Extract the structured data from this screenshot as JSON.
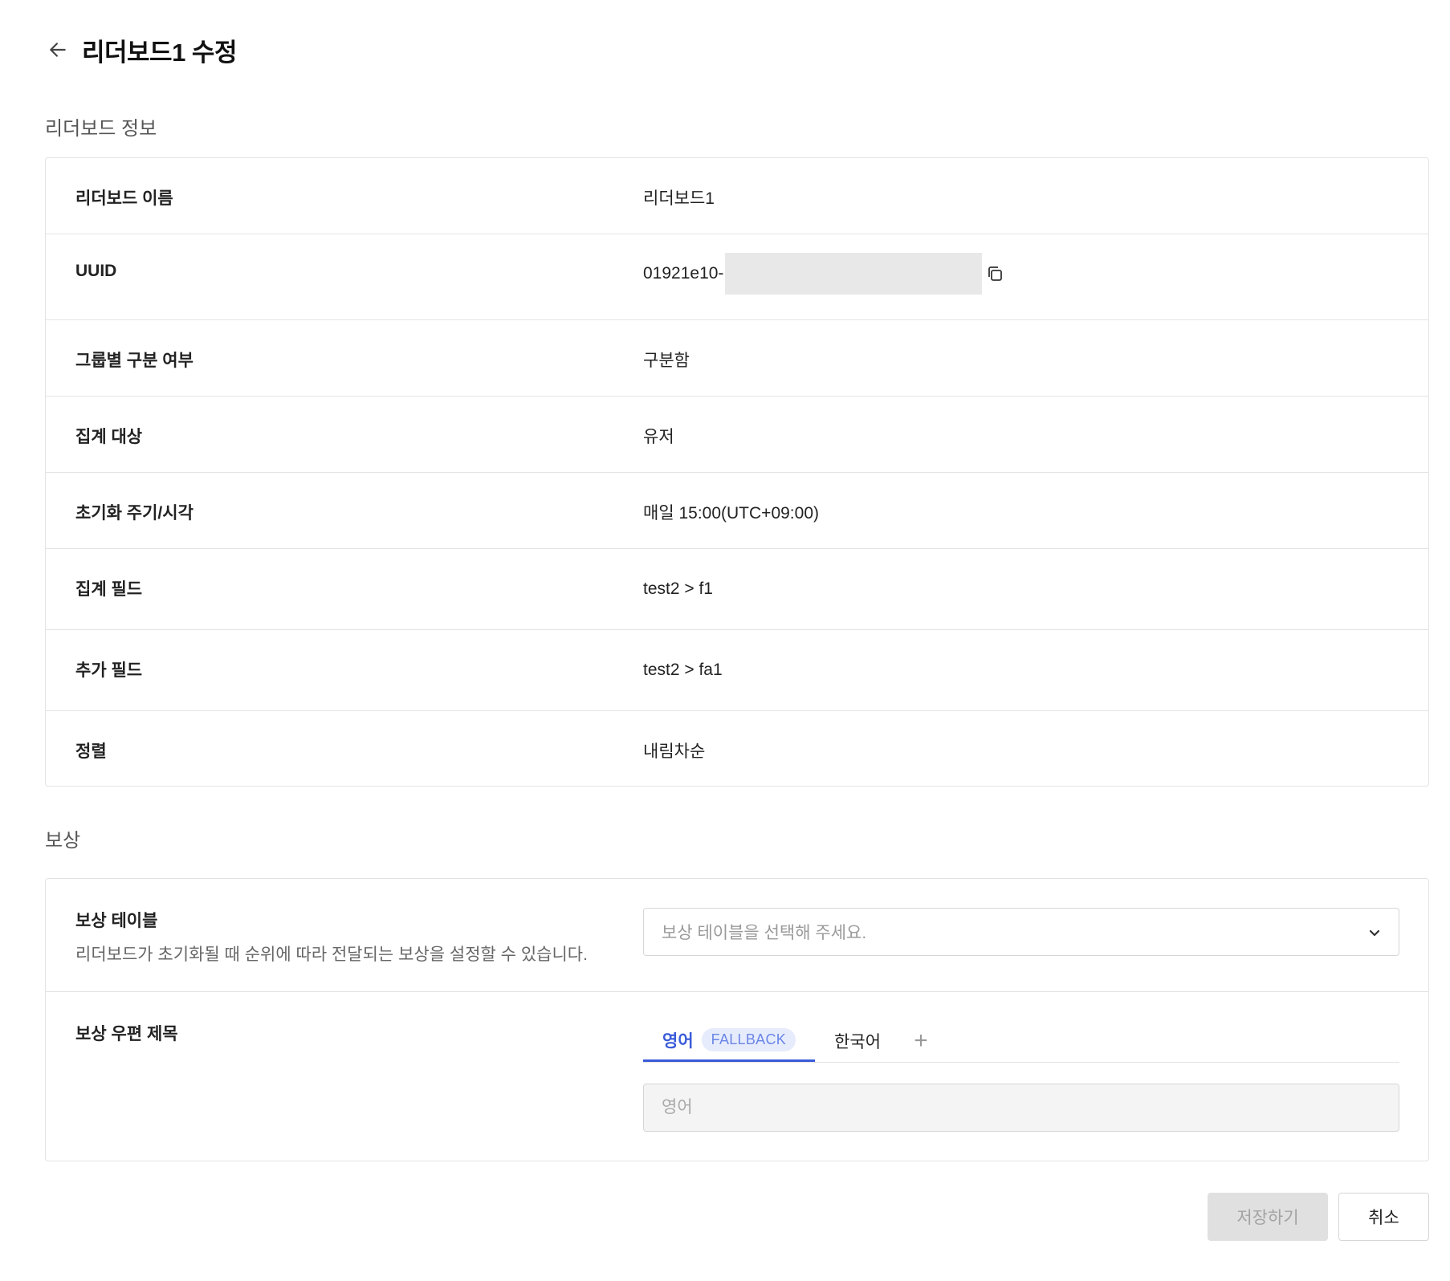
{
  "header": {
    "title": "리더보드1 수정",
    "back_icon": "arrow-left-icon"
  },
  "info_section": {
    "title": "리더보드 정보",
    "rows": [
      {
        "label": "리더보드 이름",
        "value": "리더보드1"
      },
      {
        "label": "UUID",
        "value": "01921e10-"
      },
      {
        "label": "그룹별 구분 여부",
        "value": "구분함"
      },
      {
        "label": "집계 대상",
        "value": "유저"
      },
      {
        "label": "초기화 주기/시각",
        "value": "매일 15:00(UTC+09:00)"
      },
      {
        "label": "집계 필드",
        "value": "test2 > f1"
      },
      {
        "label": "추가 필드",
        "value": "test2 > fa1"
      },
      {
        "label": "정렬",
        "value": "내림차순"
      }
    ]
  },
  "reward_section": {
    "title": "보상",
    "table": {
      "label": "보상 테이블",
      "description": "리더보드가 초기화될 때 순위에 따라 전달되는 보상을 설정할 수 있습니다.",
      "placeholder": "보상 테이블을 선택해 주세요."
    },
    "mail_title": {
      "label": "보상 우편 제목",
      "tabs": [
        {
          "label": "영어",
          "badge": "FALLBACK",
          "active": true
        },
        {
          "label": "한국어",
          "active": false
        }
      ],
      "add_tab_label": "+",
      "input_placeholder": "영어"
    }
  },
  "footer": {
    "save_label": "저장하기",
    "cancel_label": "취소"
  },
  "colors": {
    "accent": "#3a5bd9",
    "badge_bg": "#e7ecfc",
    "border": "#e3e3e3",
    "disabled_bg": "#e0e0e0"
  }
}
